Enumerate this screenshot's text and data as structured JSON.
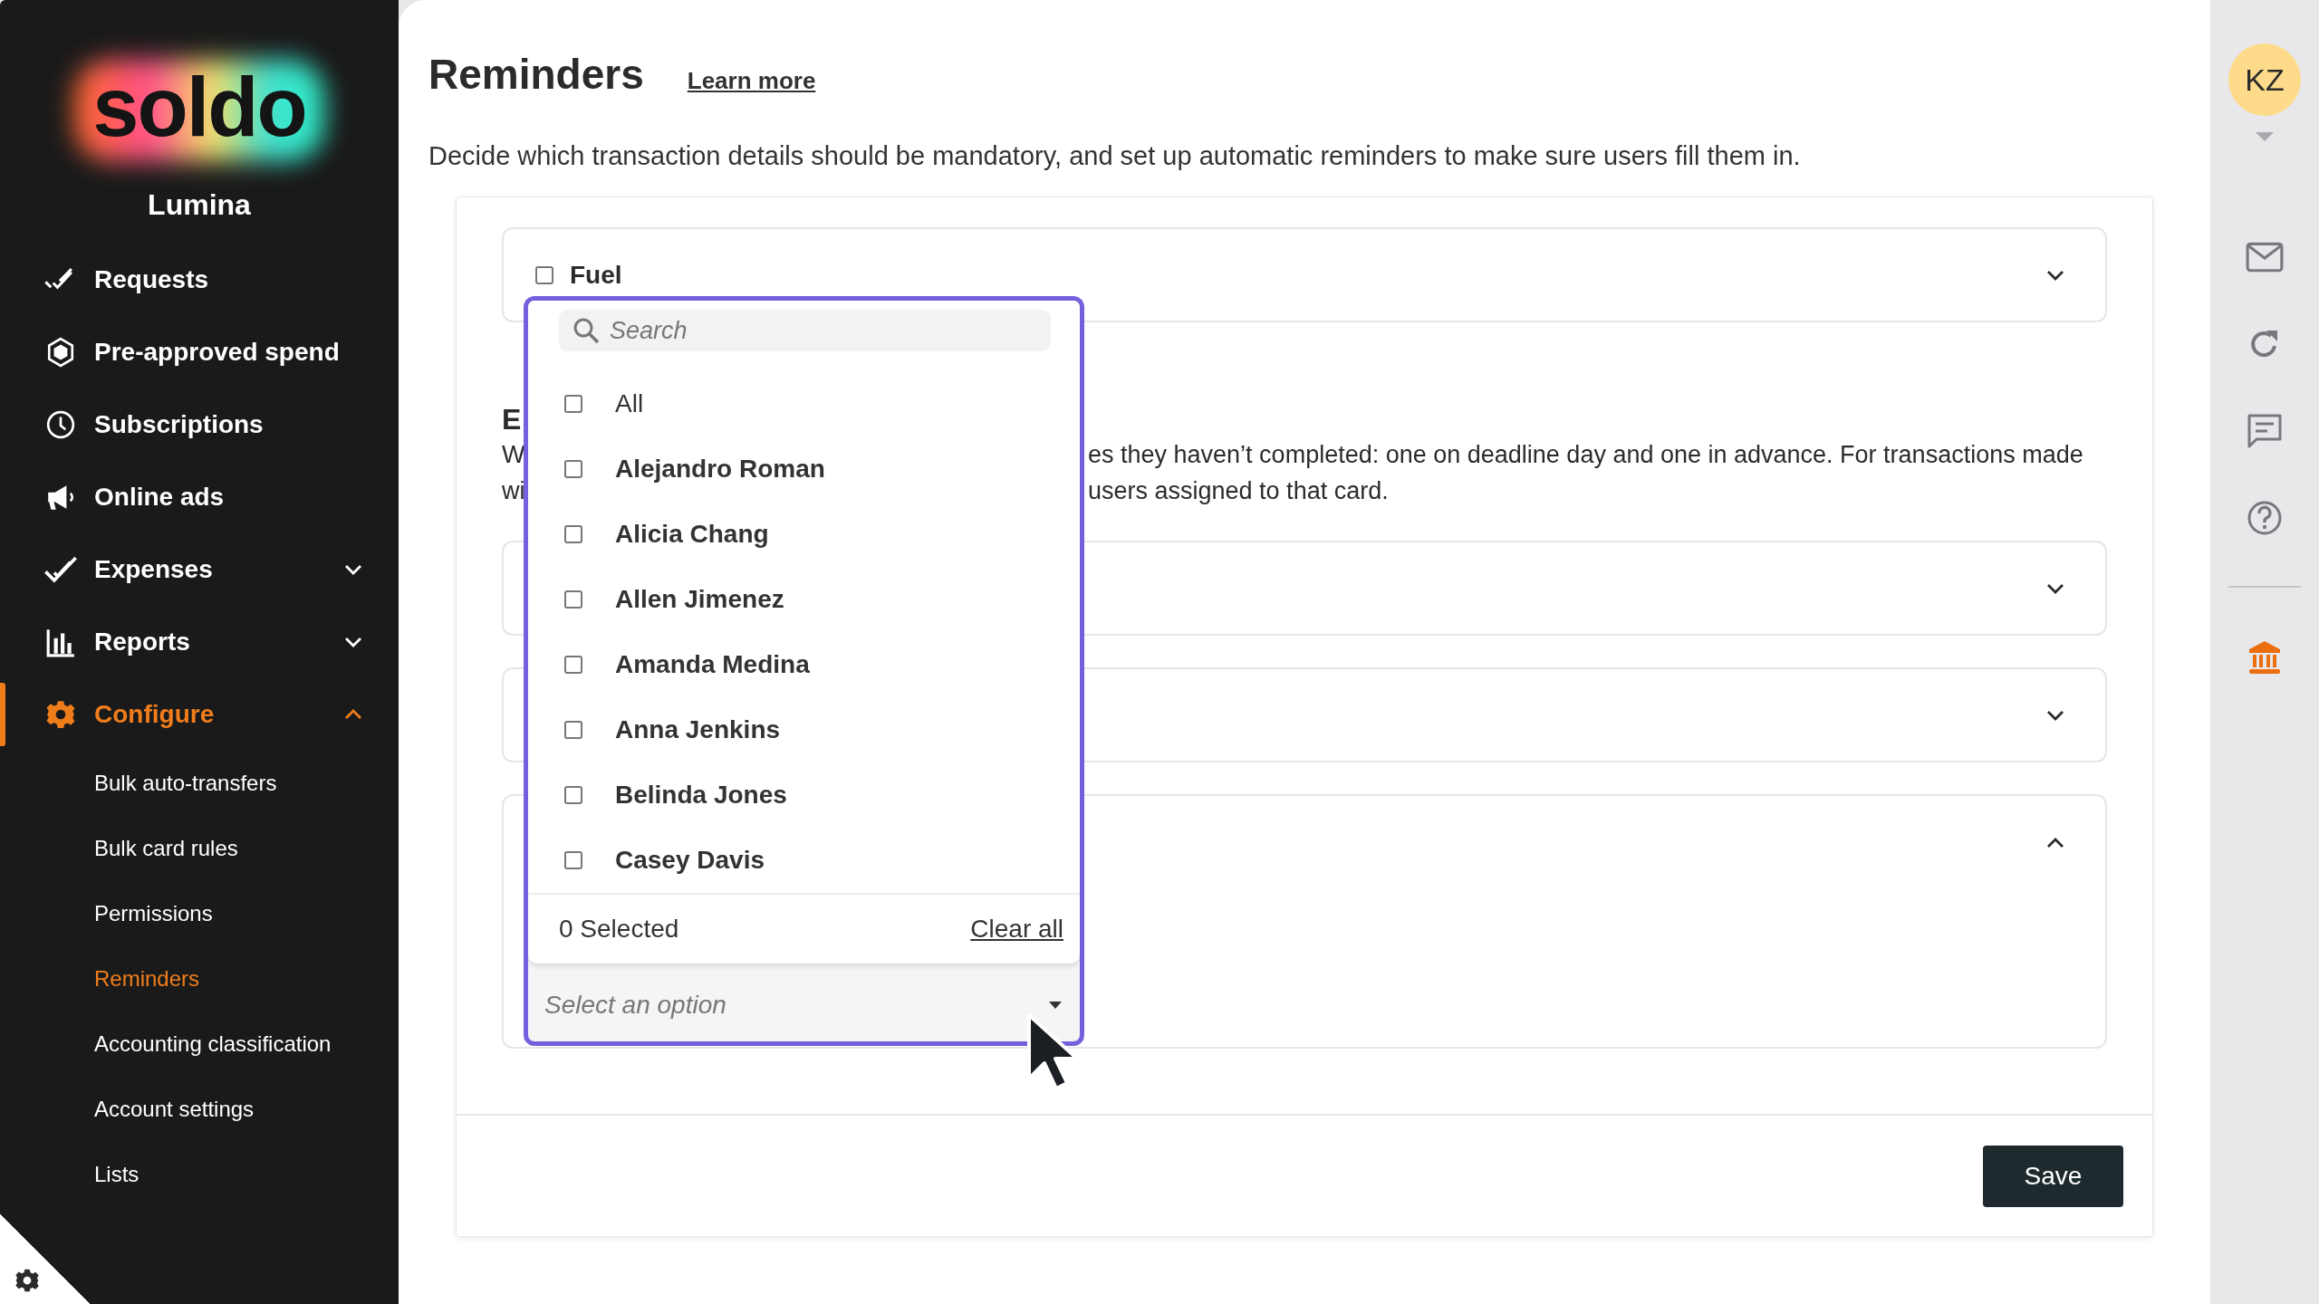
{
  "sidebar": {
    "logo": "soldo",
    "company": "Lumina",
    "items": [
      {
        "label": "Requests",
        "selected": false
      },
      {
        "label": "Pre-approved spend",
        "selected": false
      },
      {
        "label": "Subscriptions",
        "selected": false
      },
      {
        "label": "Online ads",
        "selected": false
      },
      {
        "label": "Expenses",
        "selected": false,
        "expanded": false
      },
      {
        "label": "Reports",
        "selected": false,
        "expanded": false
      },
      {
        "label": "Configure",
        "selected": true,
        "expanded": true,
        "children": [
          {
            "label": "Bulk auto-transfers",
            "selected": false
          },
          {
            "label": "Bulk card rules",
            "selected": false
          },
          {
            "label": "Permissions",
            "selected": false
          },
          {
            "label": "Reminders",
            "selected": true
          },
          {
            "label": "Accounting classification",
            "selected": false
          },
          {
            "label": "Account settings",
            "selected": false
          },
          {
            "label": "Lists",
            "selected": false
          }
        ]
      }
    ]
  },
  "page": {
    "title": "Reminders",
    "learn_more": "Learn more",
    "description": "Decide which transaction details should be mandatory, and set up automatic reminders to make sure users fill them in."
  },
  "fuel": {
    "label": "Fuel",
    "checked": false,
    "expanded": false
  },
  "section": {
    "heading": "E",
    "lines": [
      {
        "left": "W",
        "right": "es they haven’t completed: one on deadline day and one in advance. For transactions made"
      },
      {
        "left": "wi",
        "right": "users assigned to that card."
      }
    ]
  },
  "accordions": [
    {
      "expanded": false
    },
    {
      "expanded": false
    },
    {
      "expanded": true
    }
  ],
  "dropdown": {
    "search_placeholder": "Search",
    "options": [
      {
        "label": "All",
        "checked": false
      },
      {
        "label": "Alejandro Roman",
        "checked": false
      },
      {
        "label": "Alicia Chang",
        "checked": false
      },
      {
        "label": "Allen Jimenez",
        "checked": false
      },
      {
        "label": "Amanda Medina",
        "checked": false
      },
      {
        "label": "Anna Jenkins",
        "checked": false
      },
      {
        "label": "Belinda Jones",
        "checked": false
      },
      {
        "label": "Casey Davis",
        "checked": false
      }
    ],
    "selected_count": "0 Selected",
    "clear_all": "Clear all",
    "placeholder": "Select an option"
  },
  "save_button": "Save",
  "user": {
    "initials": "KZ"
  }
}
